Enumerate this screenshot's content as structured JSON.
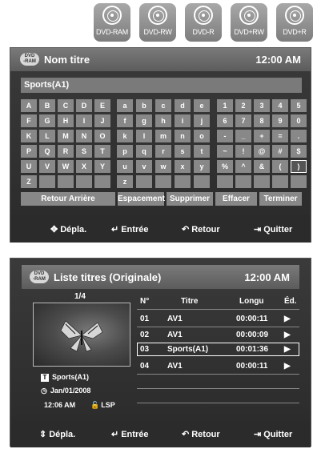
{
  "discs": [
    "DVD-RAM",
    "DVD-RW",
    "DVD-R",
    "DVD+RW",
    "DVD+R"
  ],
  "panel1": {
    "badge_top": "DVD",
    "badge_bottom": "-RAM",
    "title": "Nom titre",
    "clock": "12:00 AM",
    "input_value": "Sports(A1)",
    "keys": [
      [
        "A",
        "B",
        "C",
        "D",
        "E",
        "a",
        "b",
        "c",
        "d",
        "e",
        "1",
        "2",
        "3",
        "4",
        "5"
      ],
      [
        "F",
        "G",
        "H",
        "I",
        "J",
        "f",
        "g",
        "h",
        "i",
        "j",
        "6",
        "7",
        "8",
        "9",
        "0"
      ],
      [
        "K",
        "L",
        "M",
        "N",
        "O",
        "k",
        "l",
        "m",
        "n",
        "o",
        "-",
        "_",
        "+",
        "=",
        "."
      ],
      [
        "P",
        "Q",
        "R",
        "S",
        "T",
        "p",
        "q",
        "r",
        "s",
        "t",
        "~",
        "!",
        "@",
        "#",
        "$"
      ],
      [
        "U",
        "V",
        "W",
        "X",
        "Y",
        "u",
        "v",
        "w",
        "x",
        "y",
        "%",
        "^",
        "&",
        "(",
        ")"
      ],
      [
        "Z",
        "",
        "",
        "",
        "",
        "z",
        "",
        "",
        "",
        "",
        "",
        "",
        "",
        "",
        ""
      ]
    ],
    "buttons": {
      "back": "Retour Arrière",
      "space": "Espacement",
      "delete": "Supprimer",
      "clear": "Effacer",
      "finish": "Terminer"
    },
    "footer": {
      "move": "Dépla.",
      "enter": "Entrée",
      "return": "Retour",
      "exit": "Quitter"
    }
  },
  "panel2": {
    "badge_top": "DVD",
    "badge_bottom": "-RAM",
    "title": "Liste titres (Originale)",
    "clock": "12:00 AM",
    "page": "1/4",
    "info": {
      "name": "Sports(A1)",
      "date": "Jan/01/2008",
      "time": "12:06 AM",
      "mode": "LSP"
    },
    "columns": {
      "no": "N°",
      "title": "Titre",
      "length": "Longu",
      "edit": "Éd."
    },
    "rows": [
      {
        "no": "01",
        "title": "AV1",
        "length": "00:00:11"
      },
      {
        "no": "02",
        "title": "AV1",
        "length": "00:00:09"
      },
      {
        "no": "03",
        "title": "Sports(A1)",
        "length": "00:01:36"
      },
      {
        "no": "04",
        "title": "AV1",
        "length": "00:00:11"
      }
    ],
    "footer": {
      "move": "Dépla.",
      "enter": "Entrée",
      "return": "Retour",
      "exit": "Quitter"
    }
  }
}
